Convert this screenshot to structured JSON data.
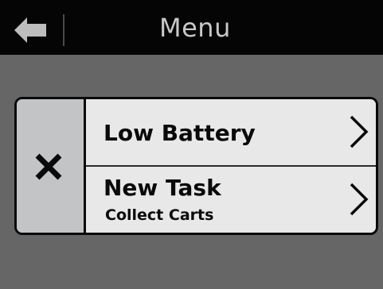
{
  "header": {
    "title": "Menu",
    "back_icon": "back-arrow-icon"
  },
  "panel": {
    "close_icon": "close-x-icon",
    "items": [
      {
        "title": "Low Battery",
        "subtitle": "",
        "icon": "chevron-right-icon"
      },
      {
        "title": "New Task",
        "subtitle": "Collect Carts",
        "icon": "chevron-right-icon"
      }
    ]
  },
  "colors": {
    "header_bg": "#050505",
    "body_bg": "#666666",
    "panel_bg": "#e6e6e6",
    "close_col_bg": "#c2c4c6",
    "title_text": "#c8c8c8"
  }
}
